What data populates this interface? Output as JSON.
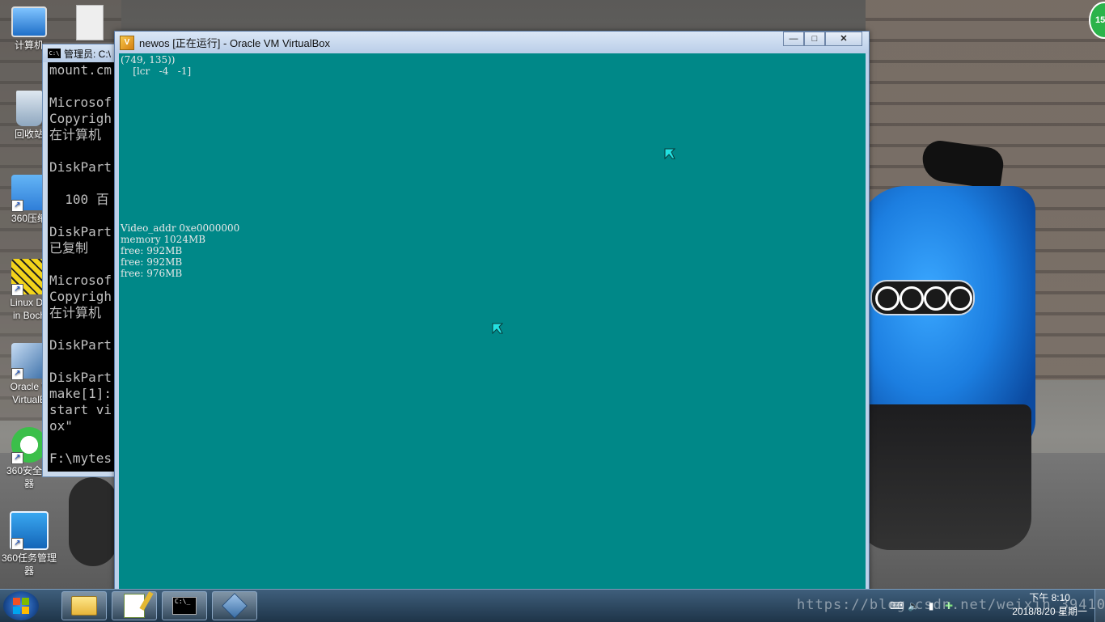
{
  "desktop": {
    "icons": [
      {
        "label": "计算机"
      },
      {
        "label": "回收站"
      },
      {
        "label": "360压缩"
      },
      {
        "label": "Linux De\nin Boch"
      },
      {
        "label": "Oracle V\nVirtualB"
      },
      {
        "label": "360安全浏\n器"
      },
      {
        "label": "360任务管理\n器"
      }
    ],
    "badge": "15"
  },
  "cmd_window": {
    "title": "管理员: C:\\",
    "icon_text": "C:\\",
    "lines": [
      "mount.cm",
      "",
      "Microsof",
      "Copyrigh",
      "在计算机",
      "",
      "DiskPart",
      "",
      "  100 百",
      "",
      "DiskPart",
      "已复制",
      "",
      "Microsof",
      "Copyrigh",
      "在计算机",
      "",
      "DiskPart",
      "",
      "DiskPart",
      "make[1]:",
      "start vi",
      "ox\"",
      "",
      "F:\\mytes"
    ]
  },
  "vbox_window": {
    "title": "newos [正在运行] - Oracle VM VirtualBox",
    "minimize": "—",
    "maximize": "□",
    "close": "✕",
    "screen_color": "#008888",
    "text": {
      "line1": "(749, 135))",
      "line2": "    [lcr   -4   -1]",
      "video_addr": "Video_addr 0xe0000000",
      "memory": "memory 1024MB",
      "free1": "free: 992MB",
      "free2": "free: 992MB",
      "free3": "free: 976MB"
    }
  },
  "taskbar": {
    "items": [
      "explorer",
      "notepad++",
      "cmd",
      "virtualbox"
    ],
    "tray": {
      "time": "下午 8:10",
      "date": "2018/8/20 星期一"
    },
    "watermark": "https://blog.csdn.net/weixin_39410618"
  }
}
